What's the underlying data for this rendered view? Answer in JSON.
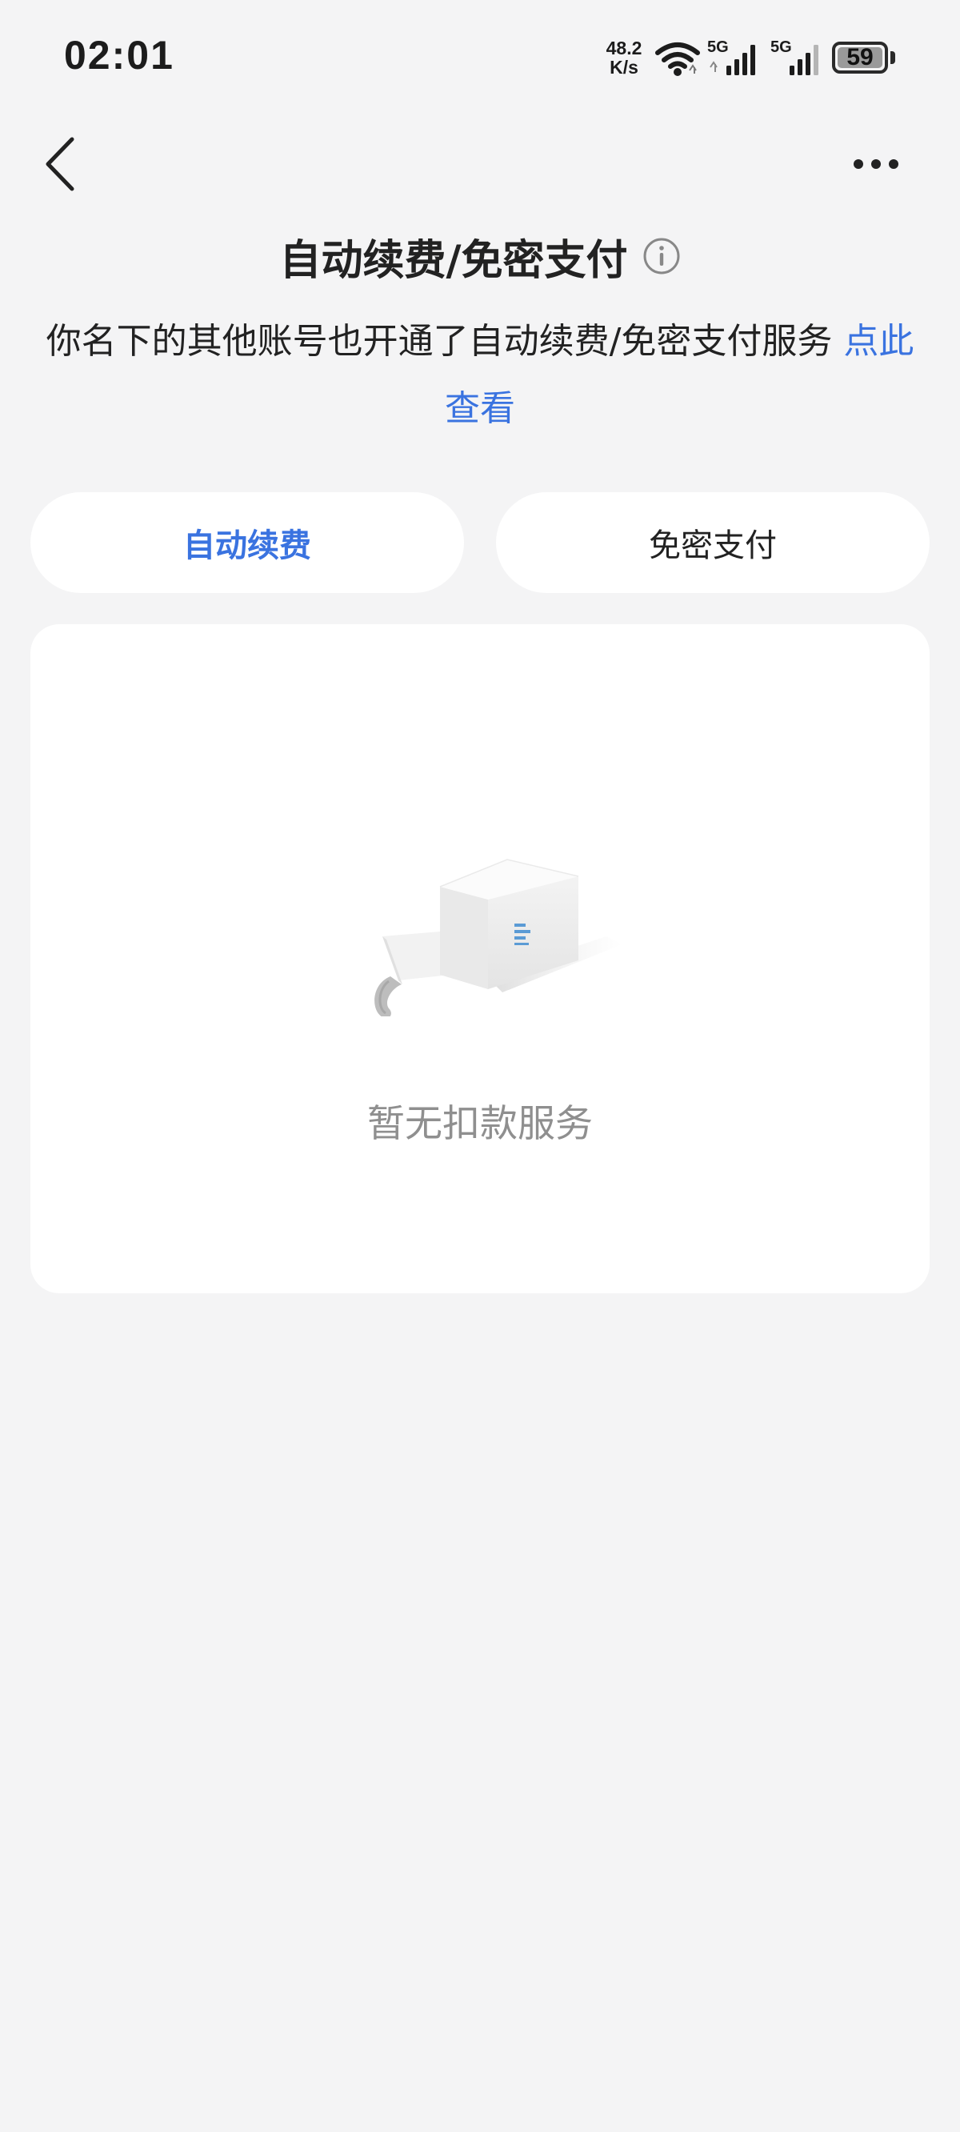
{
  "status_bar": {
    "time": "02:01",
    "net_speed_value": "48.2",
    "net_speed_unit": "K/s",
    "sim1_label": "5G",
    "sim2_label": "5G",
    "battery_level": "59"
  },
  "header": {
    "title": "自动续费/免密支付",
    "notice_text": "你名下的其他账号也开通了自动续费/免密支付服务 ",
    "notice_link": "点此查看"
  },
  "tabs": [
    {
      "label": "自动续费",
      "active": true
    },
    {
      "label": "免密支付",
      "active": false
    }
  ],
  "empty_state": {
    "message": "暂无扣款服务"
  },
  "colors": {
    "accent": "#3a73e0",
    "background": "#f4f4f5",
    "card": "#ffffff",
    "muted_text": "#8f8f8f"
  },
  "icons": [
    "back-arrow-icon",
    "more-dots-icon",
    "info-icon",
    "wifi-icon",
    "signal-icon",
    "battery-icon",
    "empty-box-icon"
  ]
}
